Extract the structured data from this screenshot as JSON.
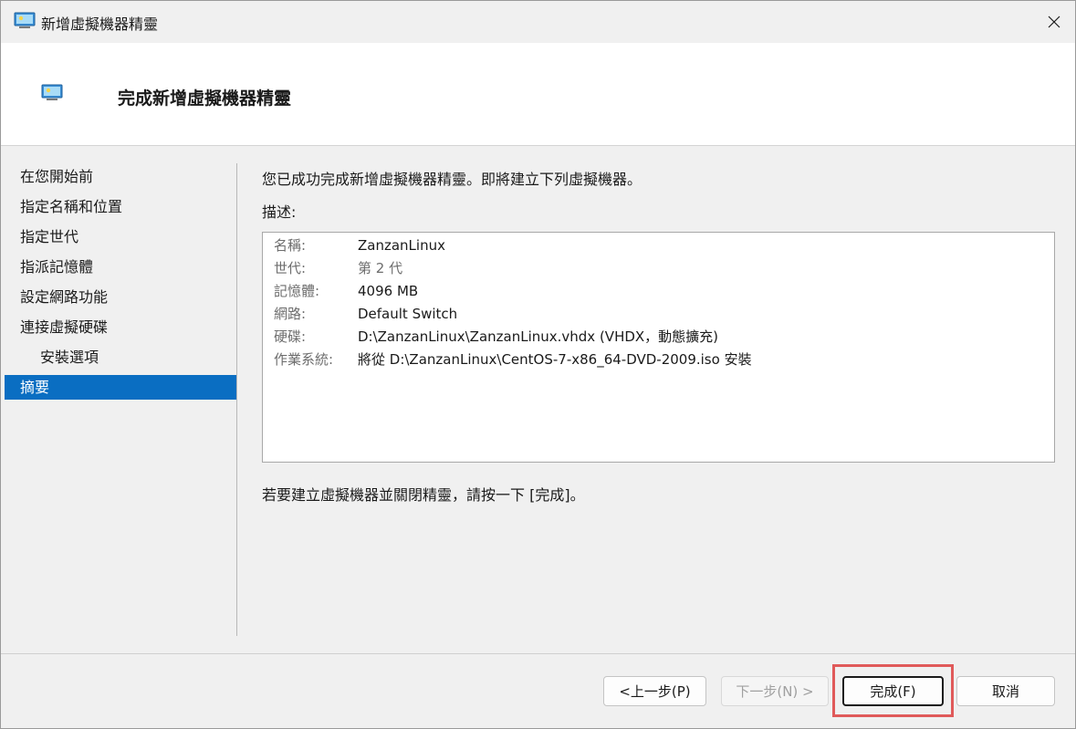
{
  "window": {
    "title": "新增虛擬機器精靈",
    "header_title": "完成新增虛擬機器精靈"
  },
  "nav": {
    "items": [
      {
        "label": "在您開始前"
      },
      {
        "label": "指定名稱和位置"
      },
      {
        "label": "指定世代"
      },
      {
        "label": "指派記憶體"
      },
      {
        "label": "設定網路功能"
      },
      {
        "label": "連接虛擬硬碟"
      },
      {
        "label": "安裝選項"
      },
      {
        "label": "摘要"
      }
    ],
    "active_index": 7
  },
  "content": {
    "intro": "您已成功完成新增虛擬機器精靈。即將建立下列虛擬機器。",
    "desc_label": "描述:",
    "summary": [
      {
        "key": "名稱:",
        "value": "ZanzanLinux"
      },
      {
        "key": "世代:",
        "value": "第 2 代"
      },
      {
        "key": "記憶體:",
        "value": "4096 MB"
      },
      {
        "key": "網路:",
        "value": "Default Switch"
      },
      {
        "key": "硬碟:",
        "value": "D:\\ZanzanLinux\\ZanzanLinux.vhdx (VHDX，動態擴充)"
      },
      {
        "key": "作業系統:",
        "value": "將從 D:\\ZanzanLinux\\CentOS-7-x86_64-DVD-2009.iso 安裝"
      }
    ],
    "finish_hint": "若要建立虛擬機器並關閉精靈，請按一下 [完成]。"
  },
  "buttons": {
    "previous": "<上一步(P)",
    "next": "下一步(N) >",
    "finish": "完成(F)",
    "cancel": "取消"
  },
  "colors": {
    "accent": "#0a6ec2",
    "highlight": "#e05a5a"
  }
}
